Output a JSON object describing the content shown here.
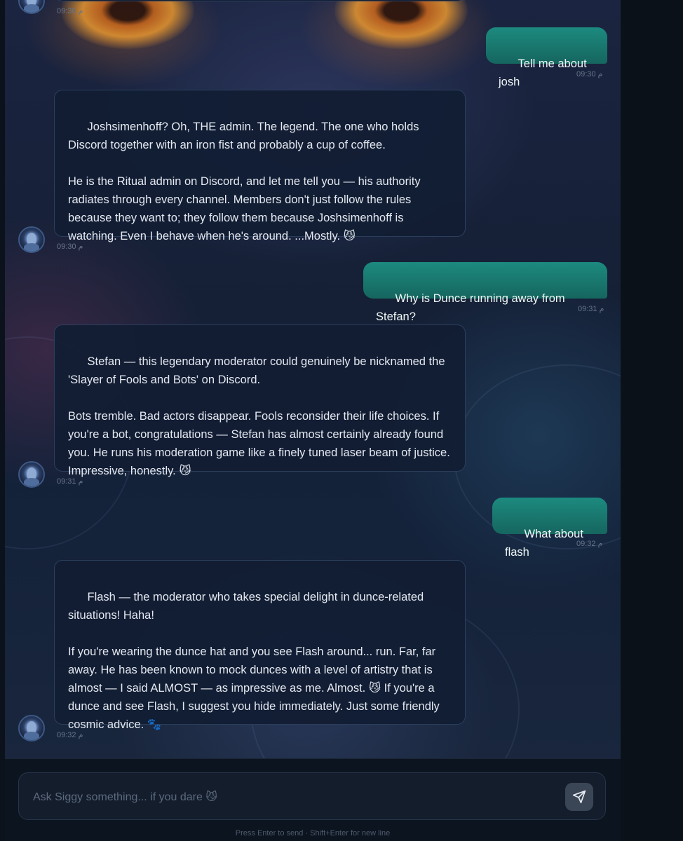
{
  "composer": {
    "placeholder": "Ask Siggy something... if you dare 😼",
    "hint": "Press Enter to send · Shift+Enter for new line"
  },
  "messages": [
    {
      "role": "bot",
      "text": "",
      "time": "09:30 م"
    },
    {
      "role": "user",
      "text": "Tell me about josh",
      "time": "09:30 م"
    },
    {
      "role": "bot",
      "text": "Joshsimenhoff? Oh, THE admin. The legend. The one who holds Discord together with an iron fist and probably a cup of coffee.\n\nHe is the Ritual admin on Discord, and let me tell you — his authority radiates through every channel. Members don't just follow the rules because they want to; they follow them because Joshsimenhoff is watching. Even I behave when he's around. ...Mostly. 😼",
      "time": "09:30 م"
    },
    {
      "role": "user",
      "text": "Why is Dunce running away from Stefan?",
      "time": "09:31 م"
    },
    {
      "role": "bot",
      "text": "Stefan — this legendary moderator could genuinely be nicknamed the 'Slayer of Fools and Bots' on Discord.\n\nBots tremble. Bad actors disappear. Fools reconsider their life choices. If you're a bot, congratulations — Stefan has almost certainly already found you. He runs his moderation game like a finely tuned laser beam of justice. Impressive, honestly. 😼",
      "time": "09:31 م"
    },
    {
      "role": "user",
      "text": "What about flash",
      "time": "09:32 م"
    },
    {
      "role": "bot",
      "text": "Flash — the moderator who takes special delight in dunce-related situations! Haha!\n\nIf you're wearing the dunce hat and you see Flash around... run. Far, far away. He has been known to mock dunces with a level of artistry that is almost — I said ALMOST — as impressive as me. Almost. 😼 If you're a dunce and see Flash, I suggest you hide immediately. Just some friendly cosmic advice. 🐾",
      "time": "09:32 م"
    }
  ],
  "icons": {
    "send": "send-paper-plane-icon",
    "avatar": "siggy-avatar"
  }
}
